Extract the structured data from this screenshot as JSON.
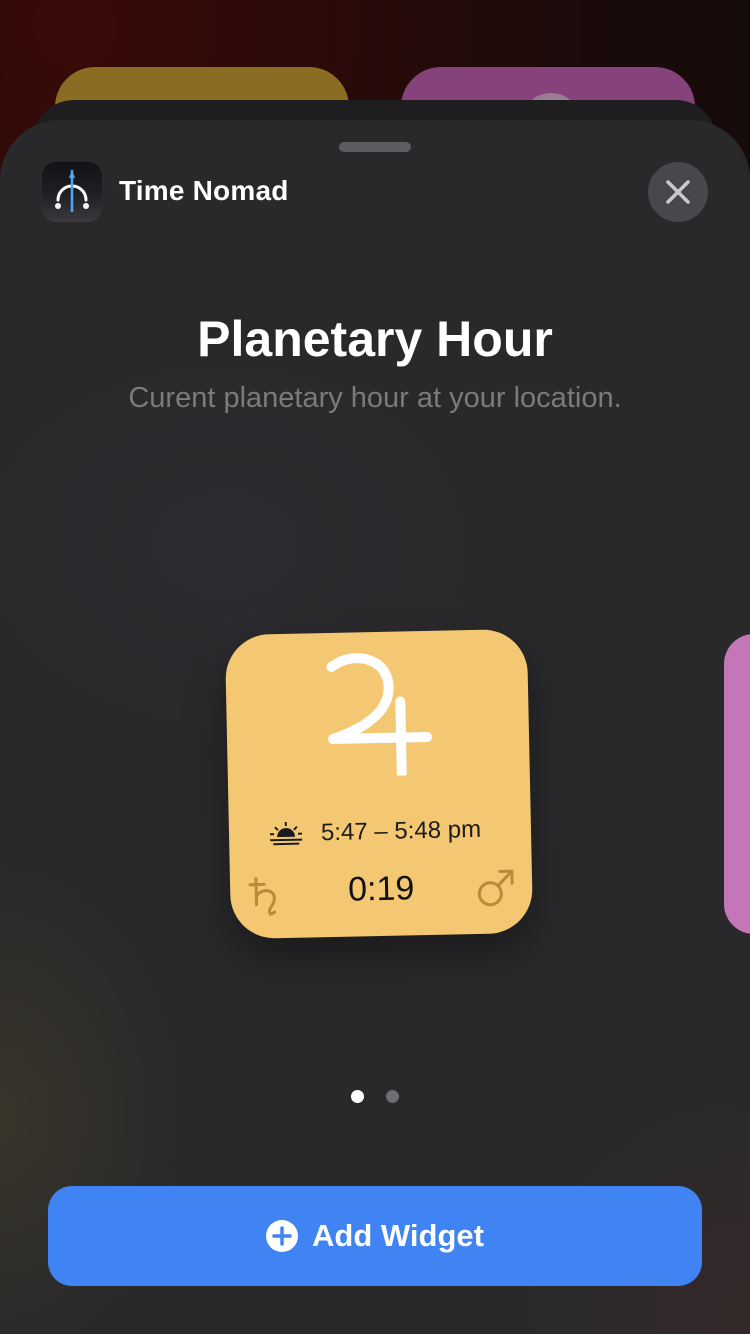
{
  "app": {
    "name": "Time Nomad",
    "icon": "time-nomad-app-icon"
  },
  "widget_gallery": {
    "title": "Planetary Hour",
    "subtitle": "Curent planetary hour at your location.",
    "page_count": 2,
    "active_page": 1
  },
  "widget": {
    "background_color": "#f4c773",
    "planet_symbol": "jupiter-icon",
    "time_range": "5:47 – 5:48 pm",
    "countdown": "0:19",
    "prev_planet": "saturn-icon",
    "next_planet": "mars-icon",
    "sun_icon": "sunrise-icon"
  },
  "actions": {
    "add_widget_label": "Add Widget",
    "close": "close-icon"
  },
  "colors": {
    "accent": "#3f84f2",
    "sheet": "#29292b",
    "next_widget": "#c477b8"
  }
}
